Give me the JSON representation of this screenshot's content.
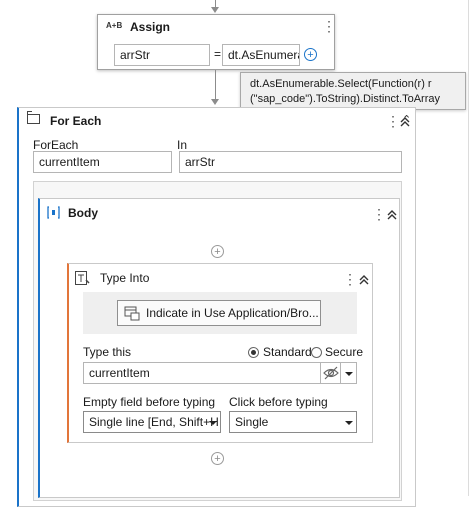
{
  "assign": {
    "icon_text": "A+B",
    "title": "Assign",
    "to_value": "arrStr",
    "equals": "=",
    "value_text": "dt.AsEnumerable",
    "tooltip_line1": "dt.AsEnumerable.Select(Function(r) r",
    "tooltip_line2": "(\"sap_code\").ToString).Distinct.ToArray"
  },
  "foreach": {
    "title": "For Each",
    "foreach_label": "ForEach",
    "foreach_value": "currentItem",
    "in_label": "In",
    "in_value": "arrStr"
  },
  "body": {
    "title": "Body"
  },
  "typeinto": {
    "title": "Type Into",
    "indicate_button": "Indicate in Use Application/Bro...",
    "type_this_label": "Type this",
    "radio_standard": "Standard",
    "radio_secure": "Secure",
    "type_this_value": "currentItem",
    "empty_field_label": "Empty field before typing",
    "empty_field_value": "Single line [End, Shift+H",
    "click_before_label": "Click before typing",
    "click_before_value": "Single"
  },
  "colors": {
    "accent": "#1a73c9",
    "typeinto_accent": "#e2753a",
    "tooltip_bg": "#f0f0f0"
  }
}
